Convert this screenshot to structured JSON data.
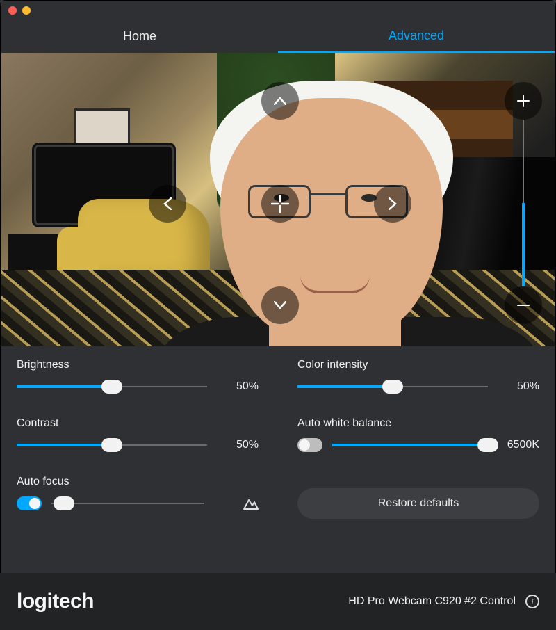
{
  "tabs": {
    "home": "Home",
    "advanced": "Advanced",
    "active": "advanced"
  },
  "zoom": {
    "percent": 50
  },
  "controls": {
    "brightness": {
      "label": "Brightness",
      "value": 50,
      "display": "50%"
    },
    "contrast": {
      "label": "Contrast",
      "value": 50,
      "display": "50%"
    },
    "autofocus": {
      "label": "Auto focus",
      "on": true,
      "value": 5
    },
    "color_intensity": {
      "label": "Color intensity",
      "value": 50,
      "display": "50%"
    },
    "auto_white_balance": {
      "label": "Auto white balance",
      "on": false,
      "value": 100,
      "display": "6500K"
    },
    "restore": "Restore defaults"
  },
  "footer": {
    "brand": "logitech",
    "device": "HD Pro Webcam C920 #2 Control"
  }
}
